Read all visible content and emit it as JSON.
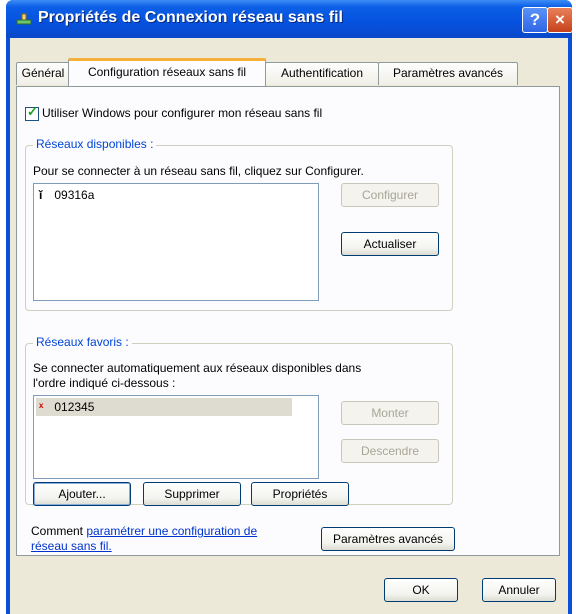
{
  "window": {
    "title": "Propriétés de Connexion réseau sans fil",
    "help_glyph": "?",
    "close_glyph": "×"
  },
  "tabs": [
    {
      "label": "Général",
      "active": false
    },
    {
      "label": "Configuration réseaux sans fil",
      "active": true
    },
    {
      "label": "Authentification",
      "active": false
    },
    {
      "label": "Paramètres avancés",
      "active": false
    }
  ],
  "use_windows": {
    "label": "Utiliser Windows pour configurer mon réseau sans fil",
    "checked": true
  },
  "available": {
    "legend": "Réseaux disponibles :",
    "description": "Pour se connecter à un réseau sans fil, cliquez sur Configurer.",
    "networks": [
      {
        "name": "09316a",
        "icon": "antenna-icon"
      }
    ],
    "configure_button": "Configurer",
    "refresh_button": "Actualiser"
  },
  "favorites": {
    "legend": "Réseaux favoris :",
    "description_line1": "Se connecter automatiquement aux réseaux disponibles dans",
    "description_line2": "l'ordre indiqué ci-dessous :",
    "networks": [
      {
        "name": "012345",
        "icon": "antenna-disconnected-icon"
      }
    ],
    "up_button": "Monter",
    "down_button": "Descendre",
    "add_button": "Ajouter...",
    "remove_button": "Supprimer",
    "properties_button": "Propriétés"
  },
  "help": {
    "prefix": "Comment ",
    "link_line1": "paramétrer une configuration de",
    "link_line2": "réseau sans fil."
  },
  "advanced_button": "Paramètres avancés",
  "footer": {
    "ok_button": "OK",
    "cancel_button": "Annuler"
  }
}
